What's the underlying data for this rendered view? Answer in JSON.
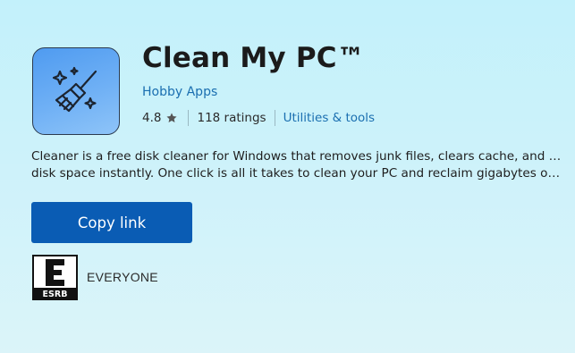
{
  "app": {
    "title": "Clean My PC™",
    "publisher": "Hobby Apps",
    "rating": "4.8",
    "ratings_count": "118 ratings",
    "category": "Utilities & tools",
    "description_line1": "Cleaner is a free disk cleaner for Windows that removes junk files, clears cache, and frees up",
    "description_line2": "disk space instantly. One click is all it takes to clean your PC and reclaim gigabytes of wasted…",
    "icon": "broom-sparkles-icon"
  },
  "actions": {
    "copy_link_label": "Copy link"
  },
  "content_rating": {
    "badge_letter": "E",
    "badge_org": "ESRB",
    "label": "EVERYONE"
  },
  "colors": {
    "accent": "#0a5cb4",
    "link": "#1a6fb0",
    "icon_bg": "#6fb0f5"
  }
}
